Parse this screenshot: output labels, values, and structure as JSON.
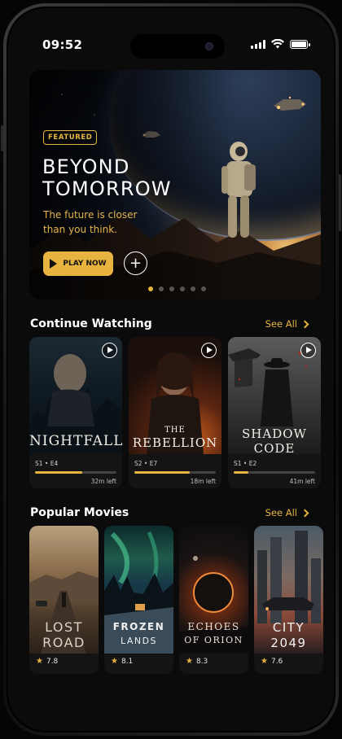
{
  "status_bar": {
    "time": "09:52"
  },
  "hero": {
    "badge": "FEATURED",
    "title_line1": "BEYOND",
    "title_line2": "TOMORROW",
    "subtitle": "The future is closer than you think.",
    "play_label": "PLAY NOW",
    "add_symbol": "+",
    "carousel": {
      "count": 6,
      "active_index": 0
    }
  },
  "continue_watching": {
    "title": "Continue Watching",
    "see_all": "See All",
    "items": [
      {
        "title_line1": "NIGHTFALL",
        "title_line2": "",
        "episode": "S1 • E4",
        "time_left": "32m left",
        "progress": 0.58
      },
      {
        "title_line1": "THE",
        "title_line2": "REBELLION",
        "episode": "S2 • E7",
        "time_left": "18m left",
        "progress": 0.68
      },
      {
        "title_line1": "SHADOW",
        "title_line2": "CODE",
        "episode": "S1 • E2",
        "time_left": "41m left",
        "progress": 0.18
      }
    ]
  },
  "popular_movies": {
    "title": "Popular Movies",
    "see_all": "See All",
    "items": [
      {
        "title_line1": "LOST",
        "title_line2": "ROAD",
        "rating": "7.8"
      },
      {
        "title_line1": "FROZEN",
        "title_line2": "LANDS",
        "rating": "8.1"
      },
      {
        "title_line1": "ECHOES",
        "title_line2": "OF ORION",
        "rating": "8.3"
      },
      {
        "title_line1": "CITY",
        "title_line2": "2049",
        "rating": "7.6"
      }
    ]
  },
  "colors": {
    "accent": "#e8b440",
    "background": "#0b0b0c"
  }
}
